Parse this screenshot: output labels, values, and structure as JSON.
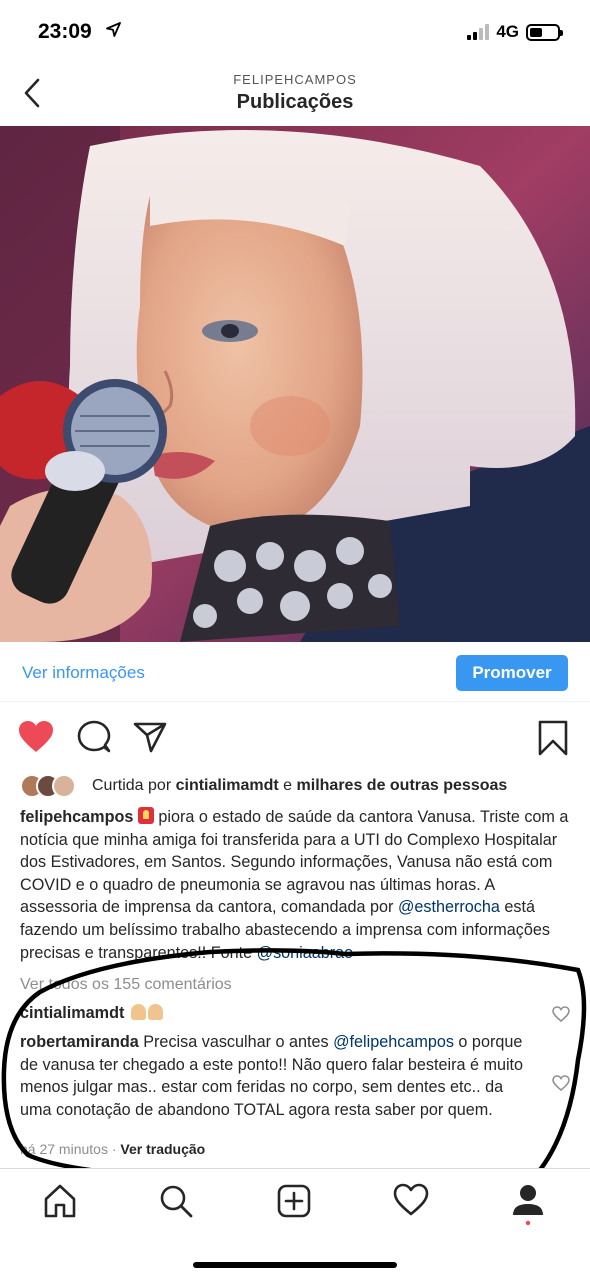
{
  "status_bar": {
    "time": "23:09",
    "network": "4G"
  },
  "header": {
    "account": "FELIPEHCAMPOS",
    "title": "Publicações"
  },
  "post_bar": {
    "info_link": "Ver informações",
    "promote_label": "Promover"
  },
  "likes": {
    "prefix": "Curtida por ",
    "user": "cintialimamdt",
    "connector": " e ",
    "others": "milhares de outras pessoas"
  },
  "caption": {
    "user": "felipehcampos",
    "part1": " piora o estado de saúde da cantora Vanusa. Triste com a notícia que minha amiga foi transferida para a UTI do Complexo Hospitalar dos Estivadores, em Santos. Segundo informações, Vanusa não está com COVID e o quadro de pneumonia se agravou nas últimas horas. A assessoria de imprensa da cantora, comandada por ",
    "mention1": "@estherrocha",
    "part2": " está fazendo um belíssimo trabalho abastecendo a imprensa com informações precisas e transparentes!! Fonte ",
    "mention2": "@soniaabrao"
  },
  "view_all_comments": "Ver todos os 155 comentários",
  "comments": [
    {
      "user": "cintialimamdt",
      "text": ""
    },
    {
      "user": "robertamiranda",
      "text1": " Precisa vasculhar o antes ",
      "mention": "@felipehcampos",
      "text2": "  o porque de vanusa ter chegado a este ponto!! Não quero falar besteira é muito menos julgar mas.. estar com feridas no corpo, sem dentes etc.. da uma conotação de abandono TOTAL agora resta saber por quem."
    }
  ],
  "meta": {
    "time_ago": "há 27 minutos",
    "separator": " · ",
    "translate": "Ver tradução"
  },
  "icons": {
    "back": "chevron-left-icon",
    "like": "heart-filled-icon",
    "comment": "comment-bubble-icon",
    "share": "paper-plane-icon",
    "save": "bookmark-icon",
    "home": "home-icon",
    "search": "search-icon",
    "add": "add-post-icon",
    "activity": "heart-outline-icon",
    "profile": "profile-icon"
  },
  "colors": {
    "accent": "#3897f0",
    "like": "#ed4956",
    "mention": "#003569",
    "muted": "#8e8e8e"
  }
}
